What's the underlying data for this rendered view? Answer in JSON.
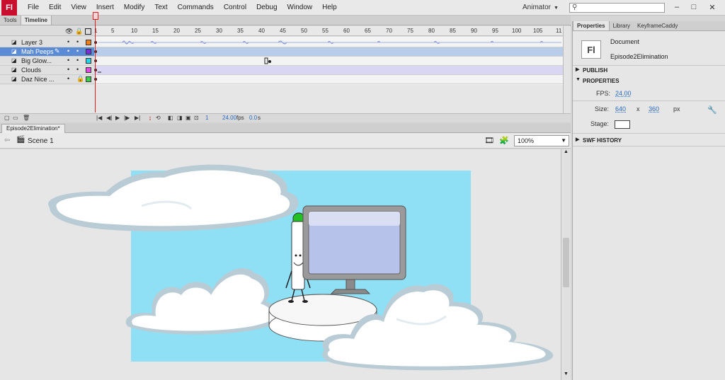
{
  "app": {
    "logo": "Fl",
    "menu": [
      "File",
      "Edit",
      "View",
      "Insert",
      "Modify",
      "Text",
      "Commands",
      "Control",
      "Debug",
      "Window",
      "Help"
    ],
    "workspace": "Animator",
    "search_placeholder": "",
    "window_buttons": [
      "–",
      "□",
      "✕"
    ]
  },
  "timeline": {
    "tabs": [
      "Tools",
      "Timeline"
    ],
    "ruler": [
      "1",
      "5",
      "10",
      "15",
      "20",
      "25",
      "30",
      "35",
      "40",
      "45",
      "50",
      "55",
      "60",
      "65",
      "70",
      "75",
      "80",
      "85",
      "90",
      "95",
      "100",
      "105",
      "11"
    ],
    "layers": [
      {
        "name": "Layer 3",
        "color": "#f07f1a"
      },
      {
        "name": "Mah Peeps",
        "color": "#7a2fd0",
        "selected": true
      },
      {
        "name": "Big Glow...",
        "color": "#21d4e8"
      },
      {
        "name": "Clouds",
        "color": "#e04ae0"
      },
      {
        "name": "Daz Nice ...",
        "color": "#3bd14a",
        "locked": true
      }
    ],
    "status": {
      "frame": "1",
      "fps": "24.00",
      "fps_unit": "fps",
      "time": "0.0",
      "time_unit": "s"
    }
  },
  "document": {
    "tab": "Episode2Elimination*",
    "scene": "Scene 1",
    "zoom": "100%"
  },
  "properties": {
    "tabs": [
      "Properties",
      "Library",
      "KeyframeCaddy"
    ],
    "badge": "Fl",
    "doc_type": "Document",
    "doc_name": "Episode2Elimination",
    "sections": {
      "publish": "PUBLISH",
      "properties": "PROPERTIES",
      "swf_history": "SWF HISTORY"
    },
    "fps_label": "FPS:",
    "fps_value": "24.00",
    "size_label": "Size:",
    "width": "640",
    "x": "x",
    "height": "360",
    "unit": "px",
    "stage_label": "Stage:"
  },
  "colors": {
    "sky": "#8fe0f4",
    "cloud_outline": "#b9cbd5",
    "accent": "#2a6bbf",
    "selected_layer": "#5b8bd4"
  }
}
